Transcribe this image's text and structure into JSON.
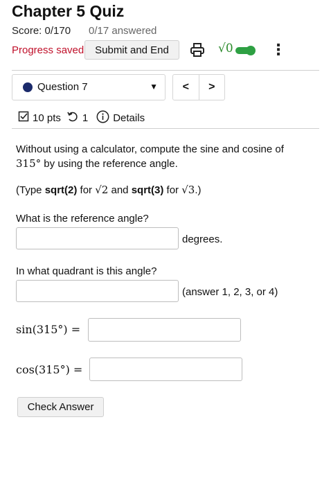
{
  "header": {
    "title": "Chapter 5 Quiz",
    "score": "Score: 0/170",
    "answered": "0/17 answered",
    "progress_status": "Progress saved",
    "submit_label": "Submit and End",
    "print_icon": "printer-icon",
    "math_mode_label": "√0",
    "toggle_state": "on",
    "toggle_color": "#2ea043",
    "more_icon": "⋮"
  },
  "question_nav": {
    "selected": "Question 7",
    "status_dot_color": "#1b2a6b",
    "prev_label": "<",
    "next_label": ">"
  },
  "meta": {
    "points": "10 pts",
    "attempts": "1",
    "details": "Details"
  },
  "question": {
    "prompt_line1": "Without using a calculator, compute the sine and cosine of",
    "prompt_angle": "315°",
    "prompt_line2_rest": " by using the reference angle.",
    "hint_prefix": "(Type ",
    "hint_sqrt2": "sqrt(2)",
    "hint_for1": " for ",
    "hint_math1": "√2",
    "hint_and": " and ",
    "hint_sqrt3": "sqrt(3)",
    "hint_for2": " for ",
    "hint_math2": "√3",
    "hint_suffix": ".)",
    "q_reference": "What is the reference angle?",
    "unit_reference": "degrees.",
    "q_quadrant": "In what quadrant is this angle?",
    "unit_quadrant": "(answer 1, 2, 3, or 4)",
    "sin_label": "sin(315°) =",
    "cos_label": "cos(315°) =",
    "reference_value": "",
    "quadrant_value": "",
    "sin_value": "",
    "cos_value": ""
  },
  "actions": {
    "check_label": "Check Answer"
  }
}
